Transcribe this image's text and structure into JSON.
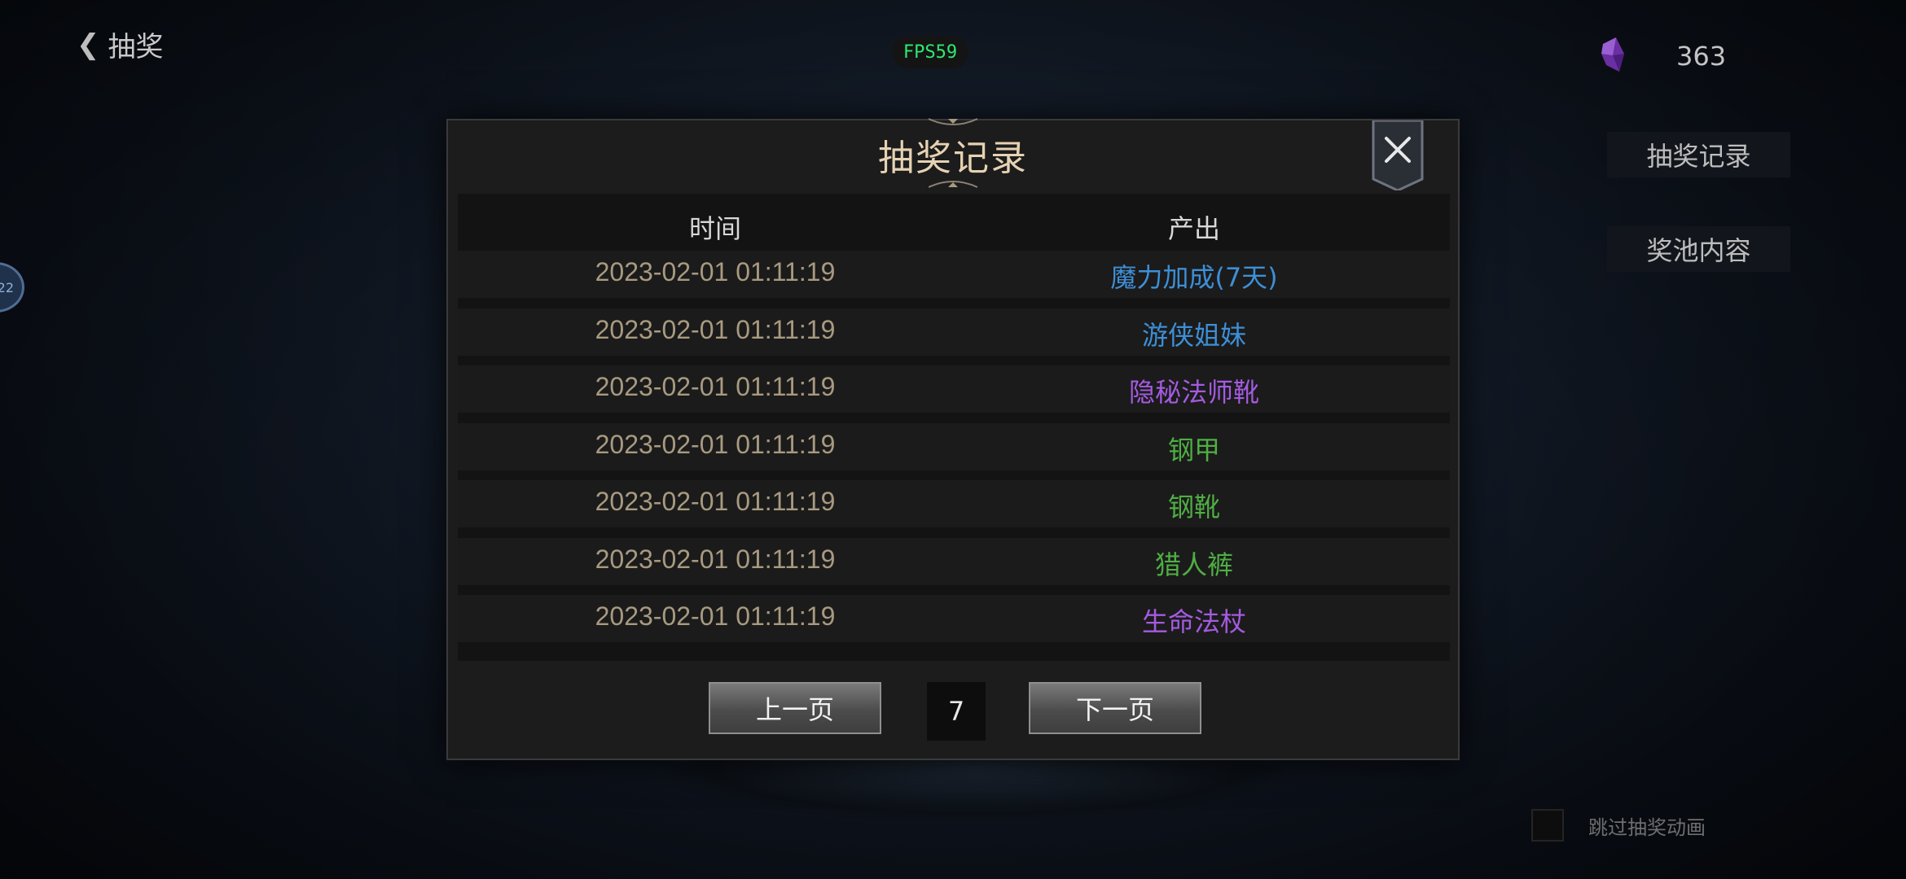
{
  "header": {
    "back_label": "抽奖",
    "fps_label": "FPS59",
    "currency_count": "363",
    "currency_icon": "purple-crystal-icon"
  },
  "side_menu": {
    "record_label": "抽奖记录",
    "pool_label": "奖池内容"
  },
  "avatar_badge": "22",
  "skip_animation_label": "跳过抽奖动画",
  "dialog": {
    "title": "抽奖记录",
    "columns": {
      "time": "时间",
      "output": "产出"
    },
    "rows": [
      {
        "time": "2023-02-01 01:11:19",
        "item": "魔力加成(7天)",
        "color": "#3d8fd6"
      },
      {
        "time": "2023-02-01 01:11:19",
        "item": "游侠姐妹",
        "color": "#3d8fd6"
      },
      {
        "time": "2023-02-01 01:11:19",
        "item": "隐秘法师靴",
        "color": "#a45be0"
      },
      {
        "time": "2023-02-01 01:11:19",
        "item": "钢甲",
        "color": "#4fae44"
      },
      {
        "time": "2023-02-01 01:11:19",
        "item": "钢靴",
        "color": "#4fae44"
      },
      {
        "time": "2023-02-01 01:11:19",
        "item": "猎人裤",
        "color": "#4fae44"
      },
      {
        "time": "2023-02-01 01:11:19",
        "item": "生命法杖",
        "color": "#a45be0"
      }
    ],
    "prev_label": "上一页",
    "page": "7",
    "next_label": "下一页"
  }
}
